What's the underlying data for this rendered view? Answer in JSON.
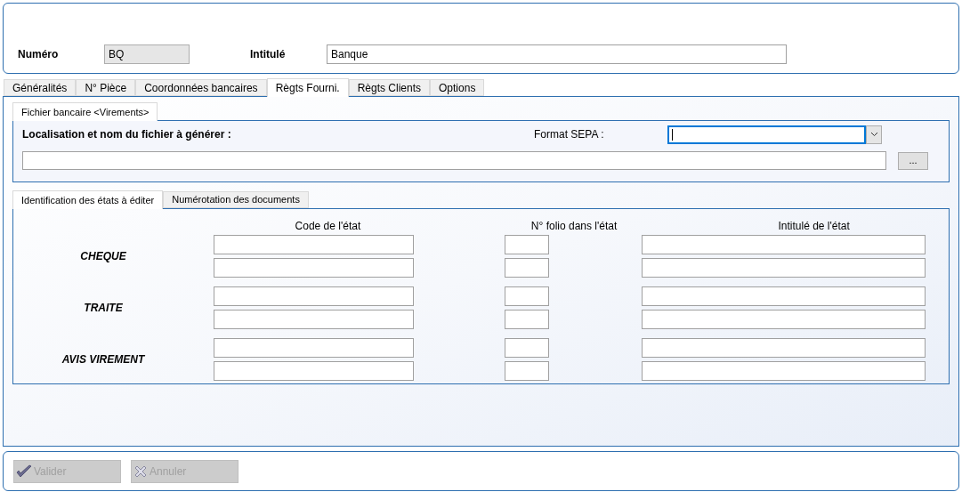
{
  "header": {
    "fields": [
      {
        "label": "Numéro",
        "value": "BQ",
        "disabled": true
      },
      {
        "label": "Intitulé",
        "value": "Banque",
        "disabled": false
      }
    ]
  },
  "tabs": [
    {
      "label": "Généralités",
      "selected": false
    },
    {
      "label": "N° Pièce",
      "selected": false
    },
    {
      "label": "Coordonnées bancaires",
      "selected": false
    },
    {
      "label": "Règts Fourni.",
      "selected": true
    },
    {
      "label": "Règts Clients",
      "selected": false
    },
    {
      "label": "Options",
      "selected": false
    }
  ],
  "file_tabs": [
    {
      "label": "Fichier bancaire <Virements>",
      "selected": true
    }
  ],
  "file_section": {
    "label": "Localisation et nom du fichier à générer :",
    "format_label": "Format SEPA :",
    "format_focused": true,
    "browse_button": "..."
  },
  "doc_tabs": [
    {
      "label": "Identification des états à éditer",
      "selected": true
    },
    {
      "label": "Numérotation des documents",
      "selected": false
    }
  ],
  "states_table": {
    "columns": [
      "Code de l'état",
      "N° folio dans l'état",
      "Intitulé de l'état"
    ],
    "rows": [
      {
        "label": "CHEQUE"
      },
      {
        "label": "TRAITE"
      },
      {
        "label": "AVIS VIREMENT"
      }
    ]
  },
  "buttons": [
    {
      "kind": "validate",
      "label": "Valider",
      "disabled": true
    },
    {
      "kind": "cancel",
      "label": "Annuler",
      "disabled": true
    }
  ]
}
